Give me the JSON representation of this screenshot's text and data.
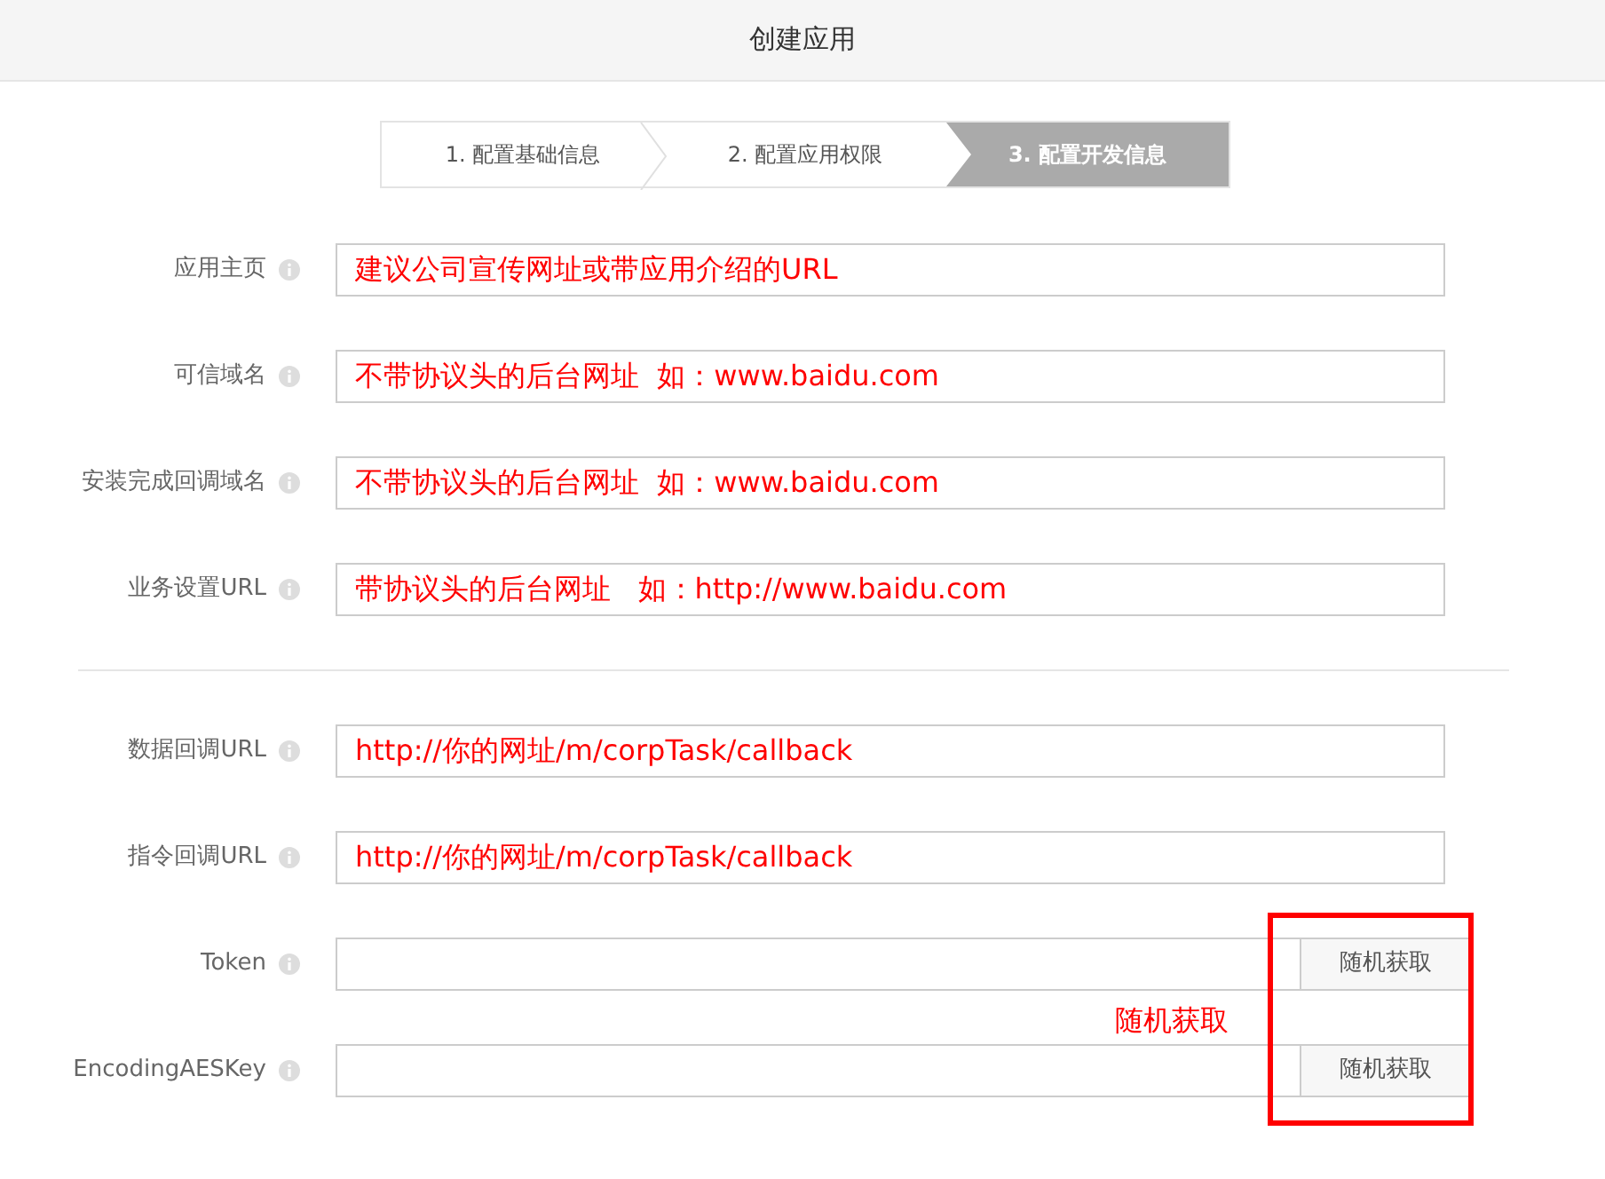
{
  "header": {
    "title": "创建应用"
  },
  "steps": [
    {
      "label": "1. 配置基础信息",
      "selected": false
    },
    {
      "label": "2. 配置应用权限",
      "selected": false
    },
    {
      "label": "3. 配置开发信息",
      "selected": true
    }
  ],
  "sections": [
    {
      "fields": [
        {
          "kind": "text",
          "label": "应用主页",
          "value": "建议公司宣传网址或带应用介绍的URL"
        },
        {
          "kind": "text",
          "label": "可信域名",
          "value": "不带协议头的后台网址  如：www.baidu.com"
        },
        {
          "kind": "text",
          "label": "安装完成回调域名",
          "value": "不带协议头的后台网址  如：www.baidu.com"
        },
        {
          "kind": "text",
          "label": "业务设置URL",
          "value": "带协议头的后台网址   如：http://www.baidu.com"
        }
      ]
    },
    {
      "fields": [
        {
          "kind": "text",
          "label": "数据回调URL",
          "value": "http://你的网址/m/corpTask/callback"
        },
        {
          "kind": "text",
          "label": "指令回调URL",
          "value": "http://你的网址/m/corpTask/callback"
        },
        {
          "kind": "token",
          "label": "Token",
          "button": "随机获取"
        },
        {
          "kind": "token",
          "label": "EncodingAESKey",
          "button": "随机获取"
        }
      ]
    }
  ],
  "annotation": {
    "note": "随机获取"
  }
}
